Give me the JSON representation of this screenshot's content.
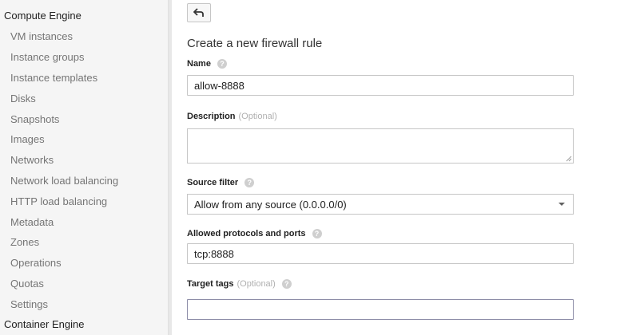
{
  "sidebar": {
    "sections": [
      "Compute Engine",
      "Container Engine"
    ],
    "items": [
      "VM instances",
      "Instance groups",
      "Instance templates",
      "Disks",
      "Snapshots",
      "Images",
      "Networks",
      "Network load balancing",
      "HTTP load balancing",
      "Metadata",
      "Zones",
      "Operations",
      "Quotas",
      "Settings"
    ]
  },
  "form": {
    "title": "Create a new firewall rule",
    "name": {
      "label": "Name",
      "value": "allow-8888"
    },
    "description": {
      "label": "Description",
      "optional": "(Optional)",
      "value": ""
    },
    "source_filter": {
      "label": "Source filter",
      "selected": "Allow from any source (0.0.0.0/0)"
    },
    "protocols": {
      "label": "Allowed protocols and ports",
      "value": "tcp:8888"
    },
    "target_tags": {
      "label": "Target tags",
      "optional": "(Optional)",
      "value": ""
    },
    "help_glyph": "?"
  },
  "icons": {
    "back": "back-arrow-icon",
    "help": "help-icon",
    "dropdown": "chevron-down-icon"
  }
}
